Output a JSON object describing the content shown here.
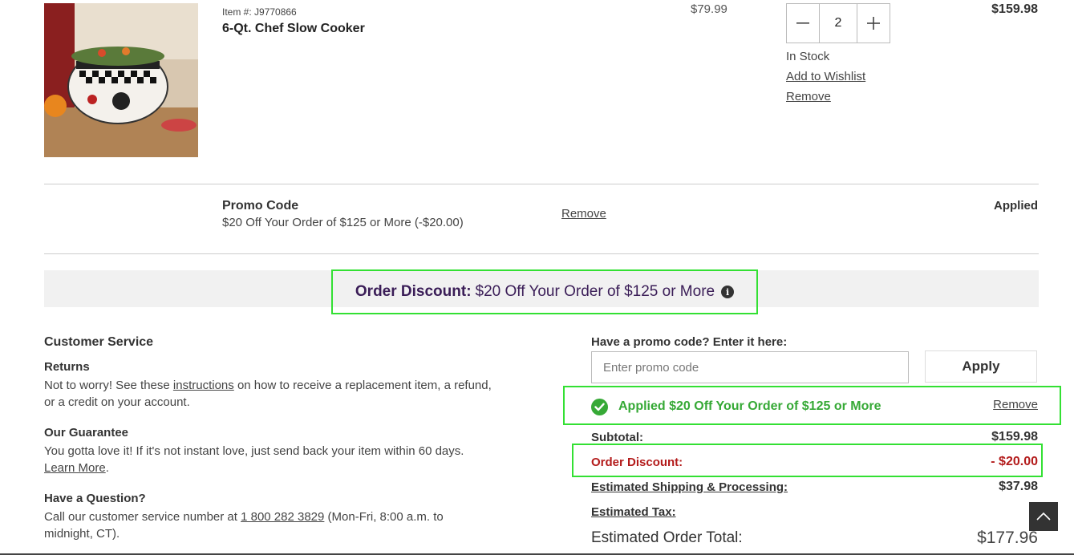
{
  "product": {
    "item_number": "Item #: J9770866",
    "name": "6-Qt. Chef Slow Cooker",
    "unit_price": "$79.99",
    "quantity": "2",
    "stock_status": "In Stock",
    "wishlist_label": "Add to Wishlist",
    "remove_label": "Remove",
    "line_total": "$159.98"
  },
  "promo_line": {
    "label": "Promo Code",
    "description": "$20 Off Your Order of $125 or More (-$20.00)",
    "remove_label": "Remove",
    "status": "Applied"
  },
  "order_discount_banner": {
    "label": "Order Discount:",
    "text": "$20 Off Your Order of $125 or More"
  },
  "customer_service": {
    "title": "Customer Service",
    "returns": {
      "heading": "Returns",
      "text_before": "Not to worry! See these ",
      "link": "instructions",
      "text_after": " on how to receive a replacement item, a refund, or a credit on your account."
    },
    "guarantee": {
      "heading": "Our Guarantee",
      "text": "You gotta love it! If it's not instant love, just send back your item within 60 days.",
      "link": "Learn More",
      "text_after": "."
    },
    "question": {
      "heading": "Have a Question?",
      "text_before": "Call our customer service number at ",
      "phone": "1 800 282 3829",
      "text_after": " (Mon-Fri, 8:00 a.m. to midnight, CT)."
    }
  },
  "promo_entry": {
    "prompt": "Have a promo code? Enter it here:",
    "placeholder": "Enter promo code",
    "apply_label": "Apply",
    "applied_message": "Applied $20 Off Your Order of $125 or More",
    "applied_remove_label": "Remove"
  },
  "summary": {
    "subtotal_label": "Subtotal:",
    "subtotal_value": "$159.98",
    "discount_label": "Order Discount:",
    "discount_value": "- $20.00",
    "shipping_label": "Estimated Shipping & Processing:",
    "shipping_value": "$37.98",
    "tax_label": "Estimated Tax:",
    "total_label": "Estimated Order Total:",
    "total_value": "$177.96"
  },
  "colors": {
    "highlight": "#33e033",
    "success": "#36a936",
    "discount_red": "#b31b1b",
    "brand_purple": "#3a1d57"
  }
}
